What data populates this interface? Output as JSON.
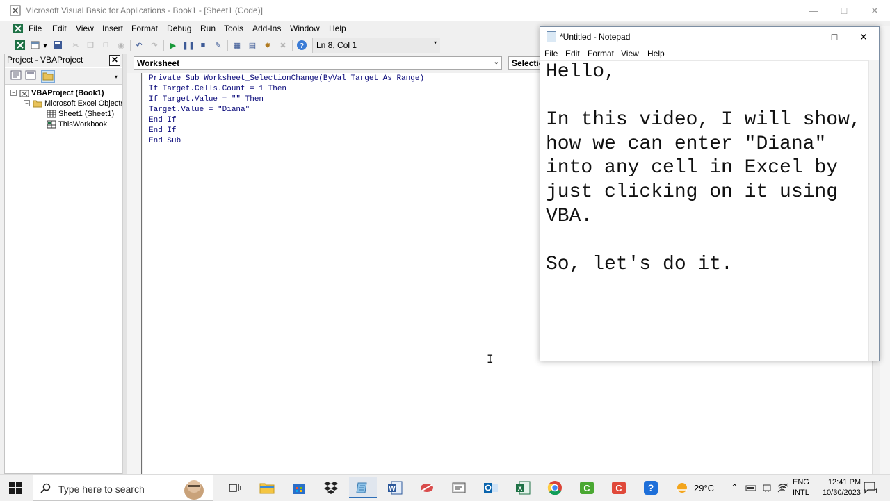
{
  "vba": {
    "title": "Microsoft Visual Basic for Applications - Book1 - [Sheet1 (Code)]",
    "menu": [
      "File",
      "Edit",
      "View",
      "Insert",
      "Format",
      "Debug",
      "Run",
      "Tools",
      "Add-Ins",
      "Window",
      "Help"
    ],
    "cursor_position": "Ln 8, Col 1",
    "project": {
      "title": "Project - VBAProject",
      "root": "VBAProject (Book1)",
      "folder": "Microsoft Excel Objects",
      "items": [
        "Sheet1 (Sheet1)",
        "ThisWorkbook"
      ]
    },
    "object_combo": "Worksheet",
    "procedure_combo": "SelectionChange",
    "code": [
      "Private Sub Worksheet_SelectionChange(ByVal Target As Range)",
      "If Target.Cells.Count = 1 Then",
      "If Target.Value = \"\" Then",
      "Target.Value = \"Diana\"",
      "End If",
      "End If",
      "End Sub"
    ]
  },
  "notepad": {
    "title": "*Untitled - Notepad",
    "menu": [
      "File",
      "Edit",
      "Format",
      "View",
      "Help"
    ],
    "lines": [
      "Hello,",
      "",
      "In this video, I will show,",
      "how we can enter \"Diana\"",
      "into any cell in Excel by",
      "just clicking on it using",
      "VBA.",
      "",
      "So, let's do it."
    ]
  },
  "taskbar": {
    "search_placeholder": "Type here to search",
    "weather": "29°C",
    "lang_top": "ENG",
    "lang_bottom": "INTL",
    "time": "12:41 PM",
    "date": "10/30/2023",
    "notification_count": "1"
  },
  "colors": {
    "code_text": "#0a0a7a",
    "accent": "#2f6fb7"
  }
}
